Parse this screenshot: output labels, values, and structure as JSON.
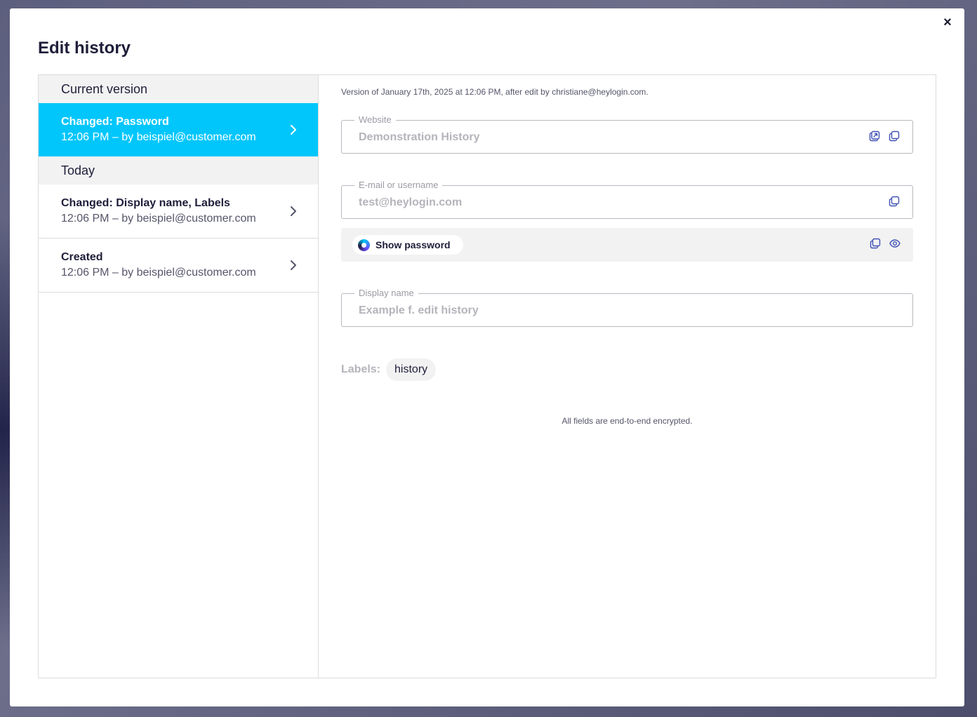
{
  "modal": {
    "title": "Edit history",
    "close_label": "×"
  },
  "history": {
    "groups": [
      {
        "header": "Current version",
        "items": [
          {
            "title": "Changed: Password",
            "subtitle": "12:06 PM – by beispiel@customer.com"
          }
        ]
      },
      {
        "header": "Today",
        "items": [
          {
            "title": "Changed: Display name, Labels",
            "subtitle": "12:06 PM – by beispiel@customer.com"
          },
          {
            "title": "Created",
            "subtitle": "12:06 PM – by beispiel@customer.com"
          }
        ]
      }
    ]
  },
  "detail": {
    "version_text": "Version of January 17th, 2025 at 12:06 PM, after edit by christiane@heylogin.com.",
    "website": {
      "label": "Website",
      "value": "Demonstration History"
    },
    "username": {
      "label": "E-mail or username",
      "value": "test@heylogin.com"
    },
    "password": {
      "show_label": "Show password"
    },
    "display_name": {
      "label": "Display name",
      "value": "Example f. edit history"
    },
    "labels": {
      "title": "Labels:",
      "tags": [
        "history"
      ]
    },
    "footer_note": "All fields are end-to-end encrypted."
  },
  "colors": {
    "accent": "#00c6fb",
    "icon": "#3f51b5",
    "text_dark": "#1e1e3a"
  },
  "icons": {
    "close": "close-icon",
    "chevron": "chevron-right-icon",
    "open_link": "open-external-icon",
    "copy": "copy-icon",
    "eye": "eye-icon",
    "logo": "heylogin-logo-icon"
  }
}
